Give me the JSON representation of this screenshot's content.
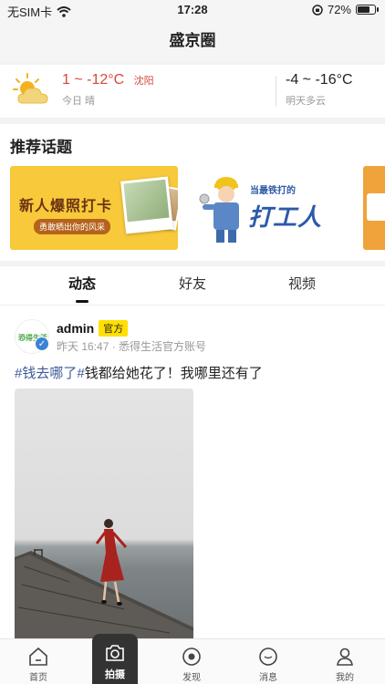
{
  "status_bar": {
    "carrier": "无SIM卡",
    "time": "17:28",
    "battery_percent": "72%",
    "battery_level": 0.72
  },
  "nav": {
    "title": "盛京圈"
  },
  "weather": {
    "today": {
      "temp": "1 ~ -12°C",
      "city": "沈阳",
      "desc": "今日 晴"
    },
    "tomorrow": {
      "temp": "-4 ~ -16°C",
      "desc": "明天多云"
    },
    "icon": "sun-cloud-icon"
  },
  "topics": {
    "heading": "推荐话题",
    "cards": [
      {
        "title": "新人爆照打卡",
        "subtitle": "勇敢晒出你的风采"
      },
      {
        "title": "打工人",
        "subtitle": "当最铁打的"
      }
    ]
  },
  "tabs": [
    {
      "label": "动态",
      "active": true
    },
    {
      "label": "好友",
      "active": false
    },
    {
      "label": "视频",
      "active": false
    }
  ],
  "post": {
    "author": "admin",
    "badge": "官方",
    "avatar_text": "恐得生活",
    "meta": "昨天 16:47 · 悉得生活官方账号",
    "tag": "#钱去哪了#",
    "text": "钱都给她花了！我哪里还有了"
  },
  "bottom_nav": [
    {
      "label": "首页",
      "icon": "home-icon"
    },
    {
      "label": "拍摄",
      "icon": "camera-icon"
    },
    {
      "label": "发现",
      "icon": "compass-icon"
    },
    {
      "label": "消息",
      "icon": "message-icon"
    },
    {
      "label": "我的",
      "icon": "user-icon"
    }
  ],
  "colors": {
    "accent_red": "#d9463b",
    "tag_blue": "#3e5a9a",
    "official_badge": "#ffe000",
    "verified_blue": "#3b82d6"
  }
}
